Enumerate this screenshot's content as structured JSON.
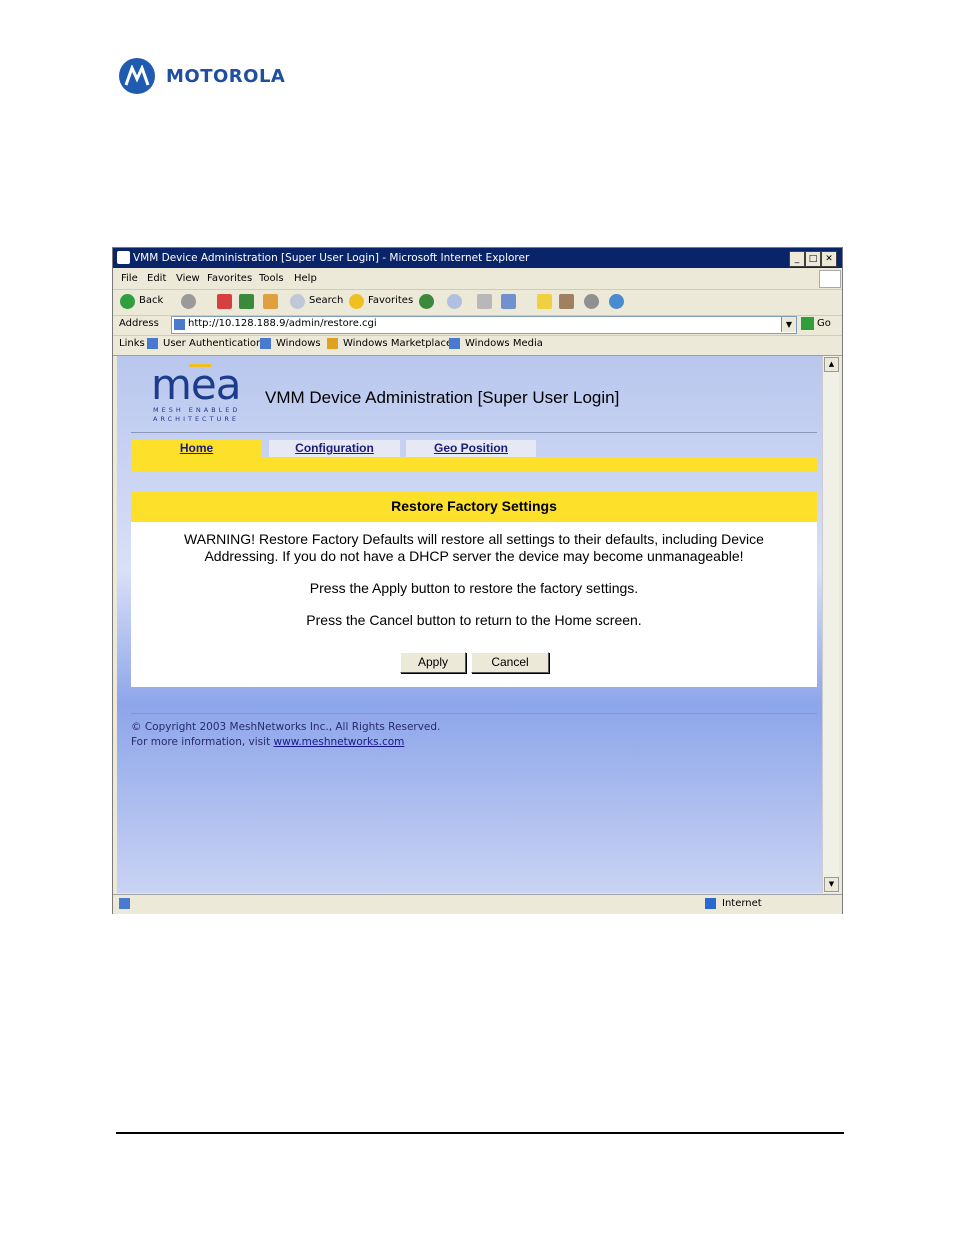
{
  "doc": {
    "brand": "MOTOROLA"
  },
  "window": {
    "title": "VMM Device Administration [Super User Login] - Microsoft Internet Explorer",
    "controls": [
      "_",
      "□",
      "✕"
    ],
    "menu": [
      "File",
      "Edit",
      "View",
      "Favorites",
      "Tools",
      "Help"
    ],
    "toolbar": {
      "back": "Back",
      "search": "Search",
      "favorites": "Favorites"
    },
    "address_label": "Address",
    "address_value": "http://10.128.188.9/admin/restore.cgi",
    "go_label": "Go",
    "links_label": "Links",
    "links": [
      "User Authentication",
      "Windows",
      "Windows Marketplace",
      "Windows Media"
    ],
    "status_zone": "Internet"
  },
  "page": {
    "logo": {
      "mark": "mea",
      "sub1": "MESH ENABLED",
      "sub2": "ARCHITECTURE"
    },
    "title": "VMM Device Administration [Super User Login]",
    "tabs": [
      "Home",
      "Configuration",
      "Geo Position"
    ],
    "panel": {
      "heading": "Restore Factory Settings",
      "warning_line1": "WARNING! Restore Factory Defaults will restore all settings to their defaults, including Device",
      "warning_line2": "Addressing. If you do not have a DHCP server the device may become unmanageable!",
      "apply_text": "Press the Apply button to restore the factory settings.",
      "cancel_text": "Press the Cancel button to return to the Home screen.",
      "apply_button": "Apply",
      "cancel_button": "Cancel"
    },
    "footer": {
      "copyright": "© Copyright 2003 MeshNetworks Inc., All Rights Reserved.",
      "more_info": "For more information, visit",
      "link": "www.meshnetworks.com"
    }
  },
  "colors": {
    "accent_yellow": "#fde02a",
    "title_blue": "#0a246a",
    "brand_blue": "#1f5bb0"
  }
}
